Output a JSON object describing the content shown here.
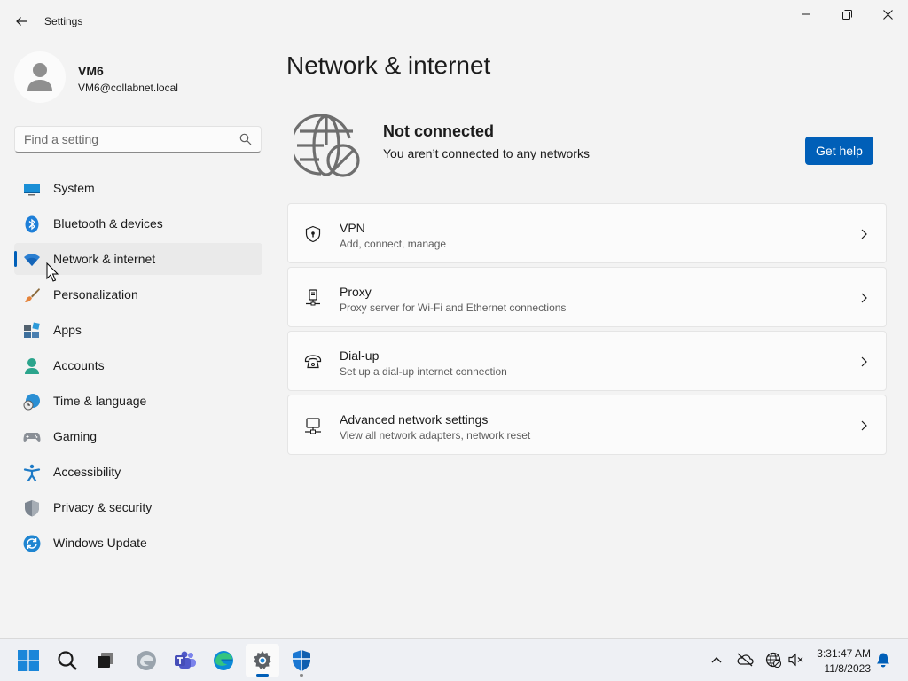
{
  "window": {
    "title": "Settings",
    "back_icon": "back-arrow-icon",
    "controls": [
      "minimize-icon",
      "maximize-icon",
      "close-icon"
    ]
  },
  "profile": {
    "name": "VM6",
    "email": "VM6@collabnet.local",
    "avatar_icon": "person-icon"
  },
  "search": {
    "placeholder": "Find a setting",
    "value": ""
  },
  "sidebar": {
    "items": [
      {
        "label": "System",
        "icon": "system-icon",
        "active": false
      },
      {
        "label": "Bluetooth & devices",
        "icon": "bluetooth-icon",
        "active": false
      },
      {
        "label": "Network & internet",
        "icon": "wifi-icon",
        "active": true
      },
      {
        "label": "Personalization",
        "icon": "brush-icon",
        "active": false
      },
      {
        "label": "Apps",
        "icon": "apps-icon",
        "active": false
      },
      {
        "label": "Accounts",
        "icon": "account-icon",
        "active": false
      },
      {
        "label": "Time & language",
        "icon": "clock-globe-icon",
        "active": false
      },
      {
        "label": "Gaming",
        "icon": "gamepad-icon",
        "active": false
      },
      {
        "label": "Accessibility",
        "icon": "accessibility-icon",
        "active": false
      },
      {
        "label": "Privacy & security",
        "icon": "shield-icon",
        "active": false
      },
      {
        "label": "Windows Update",
        "icon": "update-icon",
        "active": false
      }
    ]
  },
  "main": {
    "title": "Network & internet",
    "status": {
      "icon": "globe-blocked-icon",
      "title": "Not connected",
      "subtitle": "You aren’t connected to any networks",
      "help_button": "Get help"
    },
    "cards": [
      {
        "title": "VPN",
        "description": "Add, connect, manage",
        "icon": "vpn-shield-icon"
      },
      {
        "title": "Proxy",
        "description": "Proxy server for Wi-Fi and Ethernet connections",
        "icon": "proxy-icon"
      },
      {
        "title": "Dial-up",
        "description": "Set up a dial-up internet connection",
        "icon": "phone-icon"
      },
      {
        "title": "Advanced network settings",
        "description": "View all network adapters, network reset",
        "icon": "monitor-network-icon"
      }
    ]
  },
  "taskbar": {
    "apps": [
      "start-icon",
      "search-icon",
      "task-view-icon",
      "edge-beta-icon",
      "teams-icon",
      "edge-icon",
      "settings-icon",
      "defender-icon"
    ],
    "tray": [
      "chevron-up-icon",
      "cloud-offline-icon",
      "network-globe-icon",
      "volume-muted-icon",
      "notification-bell-icon"
    ],
    "time": "3:31:47 AM",
    "date": "11/8/2023"
  },
  "colors": {
    "accent": "#005fb8",
    "background": "#f3f3f3",
    "card": "#fbfbfb"
  }
}
